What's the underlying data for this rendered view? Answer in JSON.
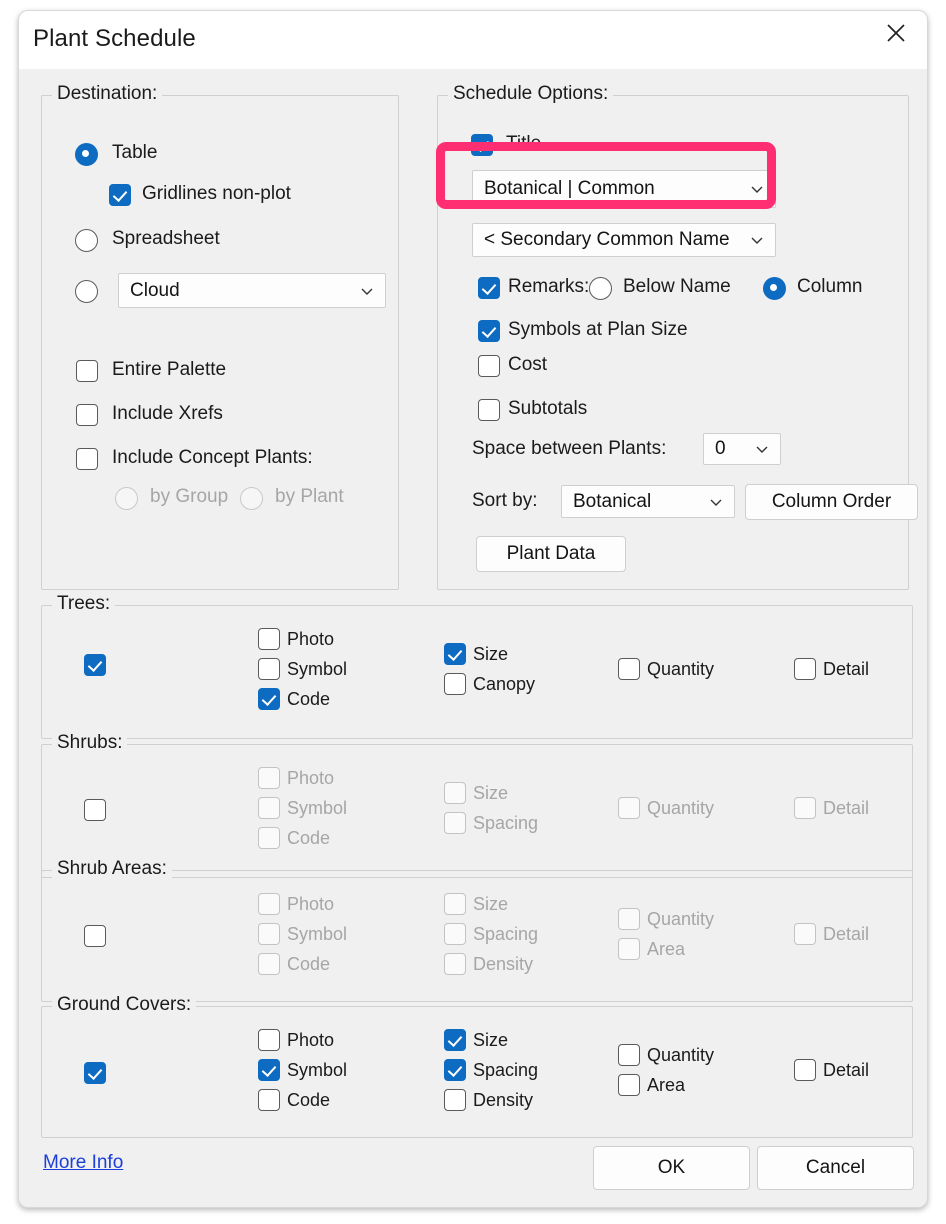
{
  "window": {
    "title": "Plant Schedule",
    "close_icon": "close-icon"
  },
  "destination": {
    "legend": "Destination:",
    "table_label": "Table",
    "table_selected": true,
    "gridlines_label": "Gridlines non-plot",
    "gridlines_checked": true,
    "spreadsheet_label": "Spreadsheet",
    "spreadsheet_selected": false,
    "cloud_selected": false,
    "cloud_value": "Cloud",
    "entire_palette_label": "Entire Palette",
    "entire_palette_checked": false,
    "include_xrefs_label": "Include Xrefs",
    "include_xrefs_checked": false,
    "include_concept_label": "Include Concept Plants:",
    "include_concept_checked": false,
    "by_group_label": "by Group",
    "by_plant_label": "by Plant"
  },
  "schedule_options": {
    "legend": "Schedule Options:",
    "title_label": "Title",
    "title_checked": true,
    "name_format_value": "Botanical   |   Common",
    "secondary_name_value": "< Secondary Common Name",
    "remarks_label": "Remarks:",
    "remarks_checked": true,
    "below_name_label": "Below Name",
    "below_name_selected": false,
    "column_label": "Column",
    "column_selected": true,
    "symbols_label": "Symbols at Plan Size",
    "symbols_checked": true,
    "cost_label": "Cost",
    "cost_checked": false,
    "subtotals_label": "Subtotals",
    "subtotals_checked": false,
    "space_between_label": "Space between Plants:",
    "space_between_value": "0",
    "sort_by_label": "Sort by:",
    "sort_by_value": "Botanical",
    "column_order_button": "Column Order",
    "plant_data_button": "Plant Data"
  },
  "categories": [
    {
      "key": "trees",
      "legend": "Trees:",
      "enabled": true,
      "master_checked": true,
      "col1": [
        {
          "label": "Photo",
          "checked": false
        },
        {
          "label": "Symbol",
          "checked": false
        },
        {
          "label": "Code",
          "checked": true
        }
      ],
      "col2": [
        {
          "label": "Size",
          "checked": true
        },
        {
          "label": "Canopy",
          "checked": false
        }
      ],
      "col3": [
        {
          "label": "Quantity",
          "checked": false
        }
      ],
      "col4": [
        {
          "label": "Detail",
          "checked": false
        }
      ]
    },
    {
      "key": "shrubs",
      "legend": "Shrubs:",
      "enabled": false,
      "master_checked": false,
      "col1": [
        {
          "label": "Photo",
          "checked": false
        },
        {
          "label": "Symbol",
          "checked": false
        },
        {
          "label": "Code",
          "checked": false
        }
      ],
      "col2": [
        {
          "label": "Size",
          "checked": false
        },
        {
          "label": "Spacing",
          "checked": false
        }
      ],
      "col3": [
        {
          "label": "Quantity",
          "checked": false
        }
      ],
      "col4": [
        {
          "label": "Detail",
          "checked": false
        }
      ]
    },
    {
      "key": "shrub-areas",
      "legend": "Shrub Areas:",
      "enabled": false,
      "master_checked": false,
      "col1": [
        {
          "label": "Photo",
          "checked": false
        },
        {
          "label": "Symbol",
          "checked": false
        },
        {
          "label": "Code",
          "checked": false
        }
      ],
      "col2": [
        {
          "label": "Size",
          "checked": false
        },
        {
          "label": "Spacing",
          "checked": false
        },
        {
          "label": "Density",
          "checked": false
        }
      ],
      "col3": [
        {
          "label": "Quantity",
          "checked": false
        },
        {
          "label": "Area",
          "checked": false
        }
      ],
      "col4": [
        {
          "label": "Detail",
          "checked": false
        }
      ]
    },
    {
      "key": "ground-covers",
      "legend": "Ground Covers:",
      "enabled": true,
      "master_checked": true,
      "col1": [
        {
          "label": "Photo",
          "checked": false
        },
        {
          "label": "Symbol",
          "checked": true
        },
        {
          "label": "Code",
          "checked": false
        }
      ],
      "col2": [
        {
          "label": "Size",
          "checked": true
        },
        {
          "label": "Spacing",
          "checked": true
        },
        {
          "label": "Density",
          "checked": false
        }
      ],
      "col3": [
        {
          "label": "Quantity",
          "checked": false
        },
        {
          "label": "Area",
          "checked": false
        }
      ],
      "col4": [
        {
          "label": "Detail",
          "checked": false
        }
      ]
    }
  ],
  "footer": {
    "more_info": "More Info",
    "ok": "OK",
    "cancel": "Cancel"
  },
  "colors": {
    "accent_blue": "#0d6bc2",
    "highlight_pink": "#ff2e73",
    "link_blue": "#1b3fd8",
    "dialog_bg": "#f0f0f0"
  }
}
